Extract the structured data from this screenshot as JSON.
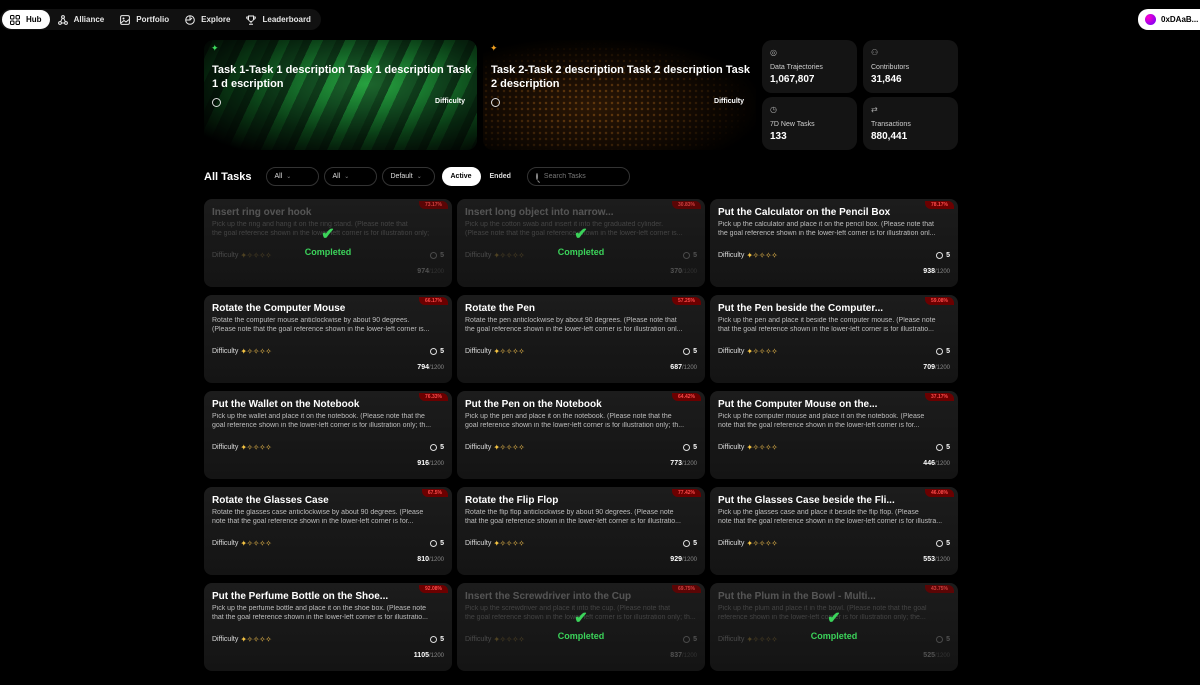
{
  "nav": {
    "items": [
      {
        "label": "Hub",
        "icon": "grid-icon",
        "active": true
      },
      {
        "label": "Alliance",
        "icon": "network-icon",
        "active": false
      },
      {
        "label": "Portfolio",
        "icon": "image-icon",
        "active": false
      },
      {
        "label": "Explore",
        "icon": "compass-icon",
        "active": false
      },
      {
        "label": "Leaderboard",
        "icon": "trophy-icon",
        "active": false
      }
    ],
    "wallet": "0xDAaB..."
  },
  "featured": [
    {
      "title": "Task 1-Task 1 description Task 1 description Task 1 d escription",
      "difficulty_label": "Difficulty"
    },
    {
      "title": "Task 2-Task 2 description Task 2 description Task 2 description",
      "difficulty_label": "Difficulty"
    }
  ],
  "stats": [
    {
      "label": "Data Trajectories",
      "value": "1,067,807"
    },
    {
      "label": "Contributors",
      "value": "31,846"
    },
    {
      "label": "7D New Tasks",
      "value": "133"
    },
    {
      "label": "Transactions",
      "value": "880,441"
    }
  ],
  "filters": {
    "title": "All Tasks",
    "select1": "All",
    "select2": "All",
    "select3": "Default",
    "toggle_active": "Active",
    "toggle_ended": "Ended",
    "search_placeholder": "Search Tasks"
  },
  "difficulty_label": "Difficulty",
  "completed_label": "Completed",
  "tasks": [
    {
      "title": "Insert ring over hook",
      "desc1": "Pick up the ring and hang it on the ring stand. (Please note that",
      "desc2": "the goal reference shown in the lower-left corner is for illustration only;",
      "badge": "73.17%",
      "time": "5",
      "count": "974",
      "total": "/1200",
      "completed": true
    },
    {
      "title": "Insert long object into narrow...",
      "desc1": "Pick up the cotton swab and insert it into the graduated cylinder.",
      "desc2": "(Please note that the goal reference shown in the lower-left corner is...",
      "badge": "30.83%",
      "time": "5",
      "count": "370",
      "total": "/1200",
      "completed": true
    },
    {
      "title": "Put the Calculator on the Pencil Box",
      "desc1": "Pick up the calculator and place it on the pencil box. (Please note that",
      "desc2": "the goal reference shown in the lower-left corner is for illustration onl...",
      "badge": "78.17%",
      "time": "5",
      "count": "938",
      "total": "/1200",
      "completed": false
    },
    {
      "title": "Rotate the Computer Mouse",
      "desc1": "Rotate the computer mouse anticlockwise by about 90 degrees.",
      "desc2": "(Please note that the goal reference shown in the lower-left corner is...",
      "badge": "66.17%",
      "time": "5",
      "count": "794",
      "total": "/1200",
      "completed": false
    },
    {
      "title": "Rotate the Pen",
      "desc1": "Rotate the pen anticlockwise by about 90 degrees. (Please note that",
      "desc2": "the goal reference shown in the lower-left corner is for illustration onl...",
      "badge": "57.25%",
      "time": "5",
      "count": "687",
      "total": "/1200",
      "completed": false
    },
    {
      "title": "Put the Pen beside the Computer...",
      "desc1": "Pick up the pen and place it beside the computer mouse. (Please note",
      "desc2": "that the goal reference shown in the lower-left corner is for illustratio...",
      "badge": "59.08%",
      "time": "5",
      "count": "709",
      "total": "/1200",
      "completed": false
    },
    {
      "title": "Put the Wallet on the Notebook",
      "desc1": "Pick up the wallet and place it on the notebook. (Please note that the",
      "desc2": "goal reference shown in the lower-left corner is for illustration only; th...",
      "badge": "76.33%",
      "time": "5",
      "count": "916",
      "total": "/1200",
      "completed": false
    },
    {
      "title": "Put the Pen on the Notebook",
      "desc1": "Pick up the pen and place it on the notebook. (Please note that the",
      "desc2": "goal reference shown in the lower-left corner is for illustration only; th...",
      "badge": "64.42%",
      "time": "5",
      "count": "773",
      "total": "/1200",
      "completed": false
    },
    {
      "title": "Put the Computer Mouse on the...",
      "desc1": "Pick up the computer mouse and place it on the notebook. (Please",
      "desc2": "note that the goal reference shown in the lower-left corner is for...",
      "badge": "37.17%",
      "time": "5",
      "count": "446",
      "total": "/1200",
      "completed": false
    },
    {
      "title": "Rotate the Glasses Case",
      "desc1": "Rotate the glasses case anticlockwise by about 90 degrees. (Please",
      "desc2": "note that the goal reference shown in the lower-left corner is for...",
      "badge": "67.5%",
      "time": "5",
      "count": "810",
      "total": "/1200",
      "completed": false
    },
    {
      "title": "Rotate the Flip Flop",
      "desc1": "Rotate the flip flop anticlockwise by about 90 degrees. (Please note",
      "desc2": "that the goal reference shown in the lower-left corner is for illustratio...",
      "badge": "77.42%",
      "time": "5",
      "count": "929",
      "total": "/1200",
      "completed": false
    },
    {
      "title": "Put the Glasses Case beside the Fli...",
      "desc1": "Pick up the glasses case and place it beside the flip flop. (Please",
      "desc2": "note that the goal reference shown in the lower-left corner is for illustra...",
      "badge": "46.08%",
      "time": "5",
      "count": "553",
      "total": "/1200",
      "completed": false
    },
    {
      "title": "Put the Perfume Bottle on the Shoe...",
      "desc1": "Pick up the perfume bottle and place it on the shoe box. (Please note",
      "desc2": "that the goal reference shown in the lower-left corner is for illustratio...",
      "badge": "92.08%",
      "time": "5",
      "count": "1105",
      "total": "/1200",
      "completed": false
    },
    {
      "title": "Insert the Screwdriver into the Cup",
      "desc1": "Pick up the screwdriver and place it into the cup. (Please note that",
      "desc2": "the goal reference shown in the lower-left corner is for illustration only; th...",
      "badge": "69.75%",
      "time": "5",
      "count": "837",
      "total": "/1200",
      "completed": true
    },
    {
      "title": "Put the Plum in the Bowl - Multi...",
      "desc1": "Pick up the plum and place it in the bowl. (Please note that the goal",
      "desc2": "reference shown in the lower-left corner is for illustration only; the...",
      "badge": "43.75%",
      "time": "5",
      "count": "525",
      "total": "/1200",
      "completed": true
    }
  ]
}
